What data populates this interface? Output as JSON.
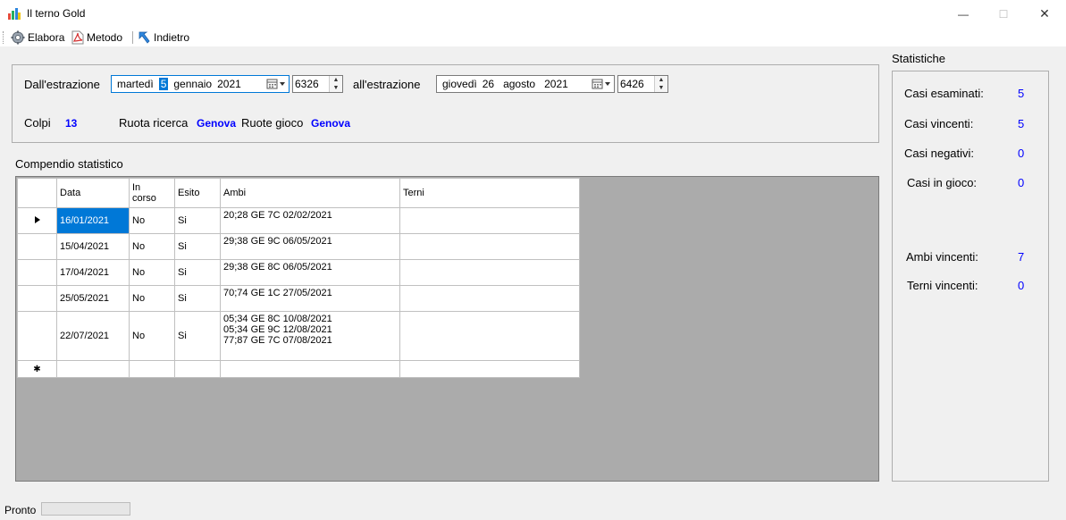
{
  "window": {
    "title": "Il terno Gold",
    "minimize": "—",
    "maximize": "☐",
    "close": "✕"
  },
  "toolbar": {
    "elabora": "Elabora",
    "metodo": "Metodo",
    "indietro": "Indietro"
  },
  "filters": {
    "from_label": "Dall'estrazione",
    "from_date": {
      "weekday": "martedì",
      "day": "5",
      "month": "gennaio",
      "year": "2021"
    },
    "from_number": "6326",
    "to_label": "all'estrazione",
    "to_date": {
      "weekday": "giovedì",
      "day": "26",
      "month": "agosto",
      "year": "2021"
    },
    "to_number": "6426",
    "colpi_label": "Colpi",
    "colpi_value": "13",
    "ruota_ricerca_label": "Ruota ricerca",
    "ruota_ricerca_value": "Genova",
    "ruote_gioco_label": "Ruote gioco",
    "ruote_gioco_value": "Genova"
  },
  "compendio": {
    "title": "Compendio statistico",
    "columns": [
      "Data",
      "In corso",
      "Esito",
      "Ambi",
      "Terni"
    ],
    "rows": [
      {
        "data": "16/01/2021",
        "in_corso": "No",
        "esito": "Si",
        "ambi": [
          "20;28 GE 7C 02/02/2021"
        ],
        "terni": ""
      },
      {
        "data": "15/04/2021",
        "in_corso": "No",
        "esito": "Si",
        "ambi": [
          "29;38 GE 9C 06/05/2021"
        ],
        "terni": ""
      },
      {
        "data": "17/04/2021",
        "in_corso": "No",
        "esito": "Si",
        "ambi": [
          "29;38 GE 8C 06/05/2021"
        ],
        "terni": ""
      },
      {
        "data": "25/05/2021",
        "in_corso": "No",
        "esito": "Si",
        "ambi": [
          "70;74 GE 1C 27/05/2021"
        ],
        "terni": ""
      },
      {
        "data": "22/07/2021",
        "in_corso": "No",
        "esito": "Si",
        "ambi": [
          "05;34 GE 8C 10/08/2021",
          "05;34 GE 9C 12/08/2021",
          "77;87 GE 7C 07/08/2021"
        ],
        "terni": ""
      }
    ]
  },
  "statistiche": {
    "title": "Statistiche",
    "items": [
      {
        "label": "Casi esaminati:",
        "value": "5"
      },
      {
        "label": "Casi vincenti:",
        "value": "5"
      },
      {
        "label": "Casi negativi:",
        "value": "0"
      },
      {
        "label": "Casi in gioco:",
        "value": "0"
      },
      {
        "label": "Ambi vincenti:",
        "value": "7"
      },
      {
        "label": "Terni vincenti:",
        "value": "0"
      }
    ]
  },
  "status": {
    "text": "Pronto",
    "progress": 0
  }
}
